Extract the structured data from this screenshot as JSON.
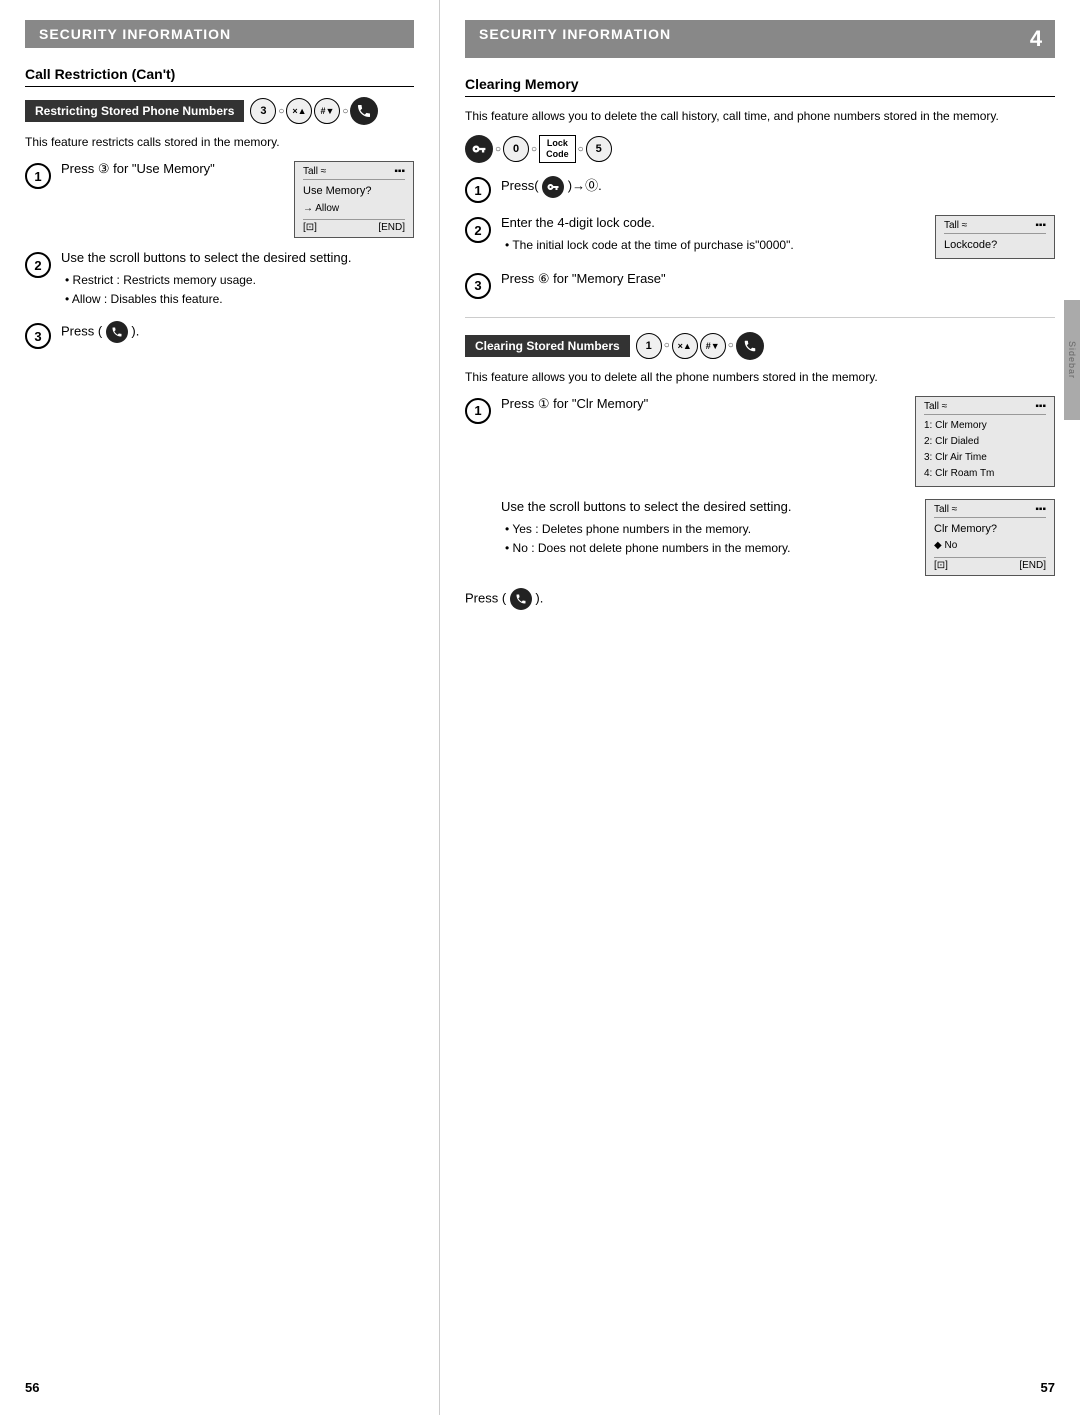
{
  "left_page": {
    "header": "SECURITY INFORMATION",
    "section_title": "Call Restriction (Can't)",
    "feature_label": "Restricting Stored Phone Numbers",
    "feature_icons": [
      "3",
      "×▲",
      "#▼",
      "🔇"
    ],
    "description": "This feature restricts calls stored in the memory.",
    "steps": [
      {
        "number": "1",
        "text": "Press ③ for \"Use Memory\"",
        "screen": {
          "signal": "Tall",
          "icon1": "≈",
          "icon2": "▪▪▪",
          "line1": "Use Memory?",
          "line2": "→ Allow",
          "footer_left": "[⊡]",
          "footer_right": "[END]"
        }
      },
      {
        "number": "2",
        "text": "Use the scroll buttons to select the desired setting.",
        "bullets": [
          "Restrict : Restricts memory usage.",
          "Allow : Disables this feature."
        ]
      },
      {
        "number": "3",
        "text": "Press ( 🔇 )."
      }
    ],
    "page_number": "56"
  },
  "right_page": {
    "header": "SECURITY INFORMATION",
    "page_number_box": "4",
    "clearing_memory": {
      "section_title": "Clearing Memory",
      "description": "This feature allows you to delete the call history, call time, and phone numbers stored in the memory.",
      "feature_icons": [
        "🔑",
        "0",
        "Lock\nCode",
        "5"
      ],
      "steps": [
        {
          "number": "1",
          "text": "Press( 🔑 )→⓪."
        },
        {
          "number": "2",
          "text": "Enter the 4-digit lock code.",
          "sub_bullet": "The initial lock code at the time of purchase is\"0000\".",
          "screen": {
            "signal": "Tall",
            "icon1": "≈",
            "icon2": "▪▪▪",
            "line1": "Lockcode?"
          }
        },
        {
          "number": "3",
          "text": "Press ⑥ for \"Memory Erase\""
        }
      ]
    },
    "clearing_stored": {
      "section_title": "Clearing Stored Numbers",
      "feature_icons": [
        "1",
        "×▲",
        "#▼",
        "🔇"
      ],
      "description": "This feature allows you to delete all the phone numbers stored in the memory.",
      "steps": [
        {
          "number": "1",
          "text": "Press ① for \"Clr Memory\"",
          "screen": {
            "signal": "Tall",
            "icon1": "≈",
            "icon2": "▪▪▪",
            "lines": [
              "1: Clr Memory",
              "2: Clr Dialed",
              "3: Clr Air Time",
              "4: Clr Roam Tm"
            ]
          }
        },
        {
          "number": "2",
          "text": "Use the scroll buttons to select the desired setting.",
          "bullets": [
            "Yes : Deletes phone numbers in the memory.",
            "No : Does not delete phone numbers in the memory."
          ],
          "screen": {
            "signal": "Tall",
            "icon1": "≈",
            "icon2": "▪▪▪",
            "line1": "Clr Memory?",
            "line2": "◆ No",
            "footer_left": "[⊡]",
            "footer_right": "[END]"
          }
        },
        {
          "number": "3",
          "text": "Press ( 🔇 )."
        }
      ]
    },
    "page_number": "57"
  }
}
